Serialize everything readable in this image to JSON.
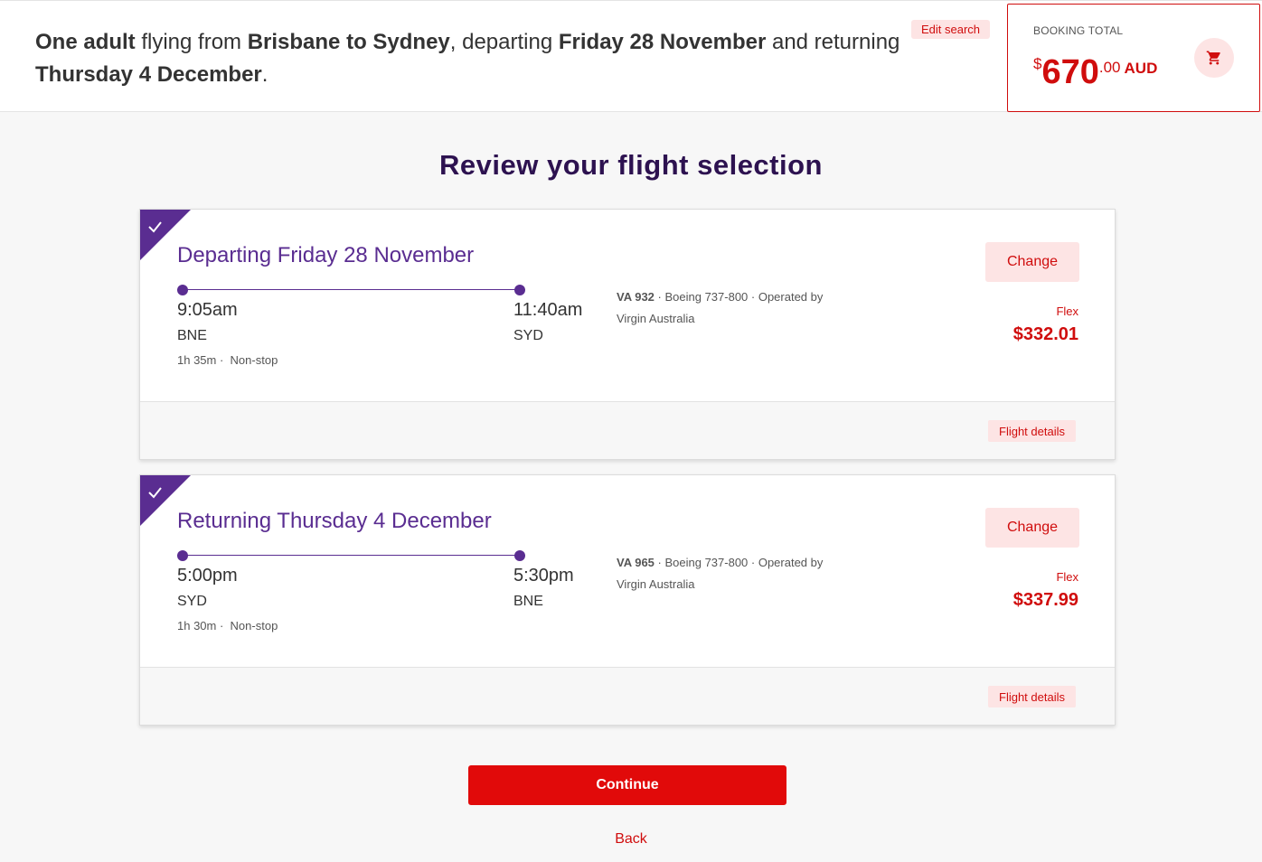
{
  "header": {
    "summary": {
      "passengers": "One adult",
      "t1": " flying from ",
      "route": "Brisbane to Sydney",
      "t2": ", departing ",
      "depart_date": "Friday 28 November",
      "t3": " and returning ",
      "return_date": "Thursday 4 December",
      "t4": "."
    },
    "edit_search_label": "Edit search",
    "booking_total": {
      "label": "BOOKING TOTAL",
      "currency_symbol": "$",
      "amount": "670",
      "cents": ".00",
      "currency_code": "AUD",
      "cart_icon": "shopping-cart-icon"
    }
  },
  "page_title": "Review your flight selection",
  "flights": [
    {
      "heading": "Departing Friday 28 November",
      "depart_time": "9:05am",
      "arrive_time": "11:40am",
      "origin": "BNE",
      "destination": "SYD",
      "duration": "1h 35m",
      "stops": "Non-stop",
      "flight_number": "VA 932",
      "aircraft": " · Boeing 737-800 · Operated by",
      "operator": "Virgin Australia",
      "fare_type": "Flex",
      "price": "$332.01",
      "change_label": "Change",
      "details_label": "Flight details",
      "selected_icon": "check-icon"
    },
    {
      "heading": "Returning Thursday 4 December",
      "depart_time": "5:00pm",
      "arrive_time": "5:30pm",
      "origin": "SYD",
      "destination": "BNE",
      "duration": "1h 30m",
      "stops": "Non-stop",
      "flight_number": "VA 965",
      "aircraft": " · Boeing 737-800 · Operated by",
      "operator": "Virgin Australia",
      "fare_type": "Flex",
      "price": "$337.99",
      "change_label": "Change",
      "details_label": "Flight details",
      "selected_icon": "check-icon"
    }
  ],
  "continue_label": "Continue",
  "back_label": "Back",
  "colors": {
    "brand_red": "#d00d0d",
    "continue_red": "#e10a0a",
    "purple": "#5a2d91",
    "title_purple": "#2d1250",
    "light_red_bg": "#fde4e4"
  }
}
